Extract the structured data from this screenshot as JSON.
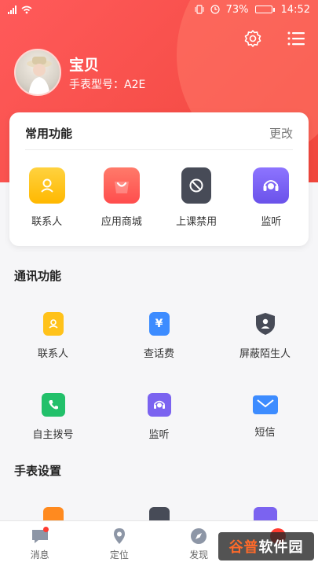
{
  "status": {
    "signal_label": "",
    "battery_percent": "73%",
    "battery_level": 0.73,
    "time": "14:52"
  },
  "profile": {
    "name": "宝贝",
    "model": "手表型号：A2E"
  },
  "common": {
    "title": "常用功能",
    "edit_label": "更改",
    "items": [
      {
        "label": "联系人",
        "icon": "contacts-icon",
        "color": "#ffc21a"
      },
      {
        "label": "应用商城",
        "icon": "shopping-bag-icon",
        "color": "#ff5a5a"
      },
      {
        "label": "上课禁用",
        "icon": "class-ban-icon",
        "color": "#474b57"
      },
      {
        "label": "监听",
        "icon": "headset-icon",
        "color": "#7b63f0"
      }
    ]
  },
  "comm": {
    "title": "通讯功能",
    "items": [
      {
        "label": "联系人",
        "icon": "contacts-icon",
        "color": "#ffc21a"
      },
      {
        "label": "查话费",
        "icon": "bill-icon",
        "color": "#3d8cff"
      },
      {
        "label": "屏蔽陌生人",
        "icon": "shield-user-icon",
        "color": "#474b57"
      },
      {
        "label": "自主拨号",
        "icon": "phone-icon",
        "color": "#22c06a"
      },
      {
        "label": "监听",
        "icon": "headset-icon",
        "color": "#7b63f0"
      },
      {
        "label": "短信",
        "icon": "mail-icon",
        "color": "#3d8cff"
      }
    ]
  },
  "watch": {
    "title": "手表设置"
  },
  "tabs": [
    {
      "label": "消息",
      "icon": "message-icon"
    },
    {
      "label": "定位",
      "icon": "location-icon"
    },
    {
      "label": "发现",
      "icon": "compass-icon"
    },
    {
      "label": "",
      "icon": "profile-icon"
    }
  ],
  "watermark": {
    "text1": "谷普",
    "text2": "软件园"
  }
}
